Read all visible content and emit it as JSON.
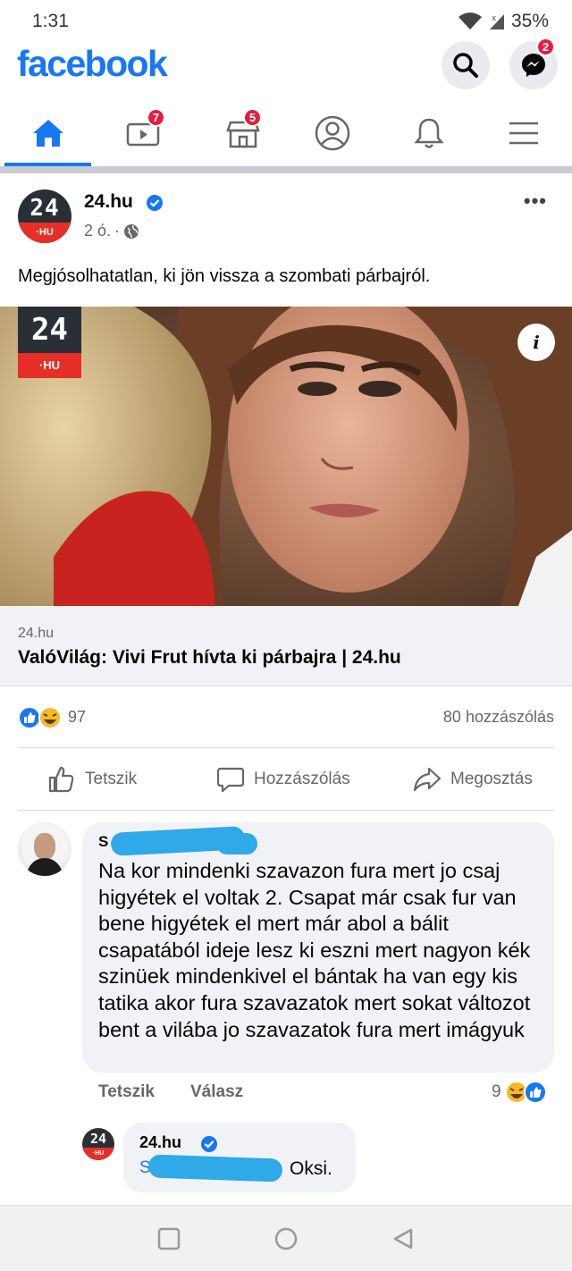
{
  "status": {
    "time": "1:31",
    "battery": "35%"
  },
  "header": {
    "logo": "facebook",
    "messenger_badge": "2"
  },
  "tabs": {
    "watch_badge": "7",
    "marketplace_badge": "5"
  },
  "post": {
    "page_name": "24.hu",
    "time": "2 ó.",
    "more": "•••",
    "text": "Megjósolhatatlan, ki jön vissza a szombati párbajról.",
    "image_logo_top": "24",
    "image_logo_bottom": "·HU",
    "link_domain": "24.hu",
    "link_title": "ValóVilág: Vivi Frut hívta ki párbajra | 24.hu",
    "reaction_count": "97",
    "comment_count": "80 hozzászólás"
  },
  "actions": {
    "like": "Tetszik",
    "comment": "Hozzászólás",
    "share": "Megosztás"
  },
  "comment": {
    "name_visible": "S",
    "text": "Na kor mindenki szavazon fura mert jo csaj higyétek el voltak 2. Csapat már csak fur van bene higyétek el mert már abol a bálit csapatából ideje lesz ki eszni mert nagyon kék szinüek mindenkivel el bántak ha van egy kis tatika akor fura szavazatok mert sokat változot bent a vilába jo szavazatok fura mert imágyuk",
    "like_label": "Tetszik",
    "reply_label": "Válasz",
    "reaction_count": "9"
  },
  "reply": {
    "page_name": "24.hu",
    "name_visible": "S",
    "text": "Oksi."
  },
  "avatar_logo": {
    "top": "24",
    "bottom": "·HU"
  },
  "colors": {
    "brand": "#1877f2",
    "badge": "#e41e3f",
    "logo_red": "#e63027",
    "redaction": "#2fa9e8"
  }
}
